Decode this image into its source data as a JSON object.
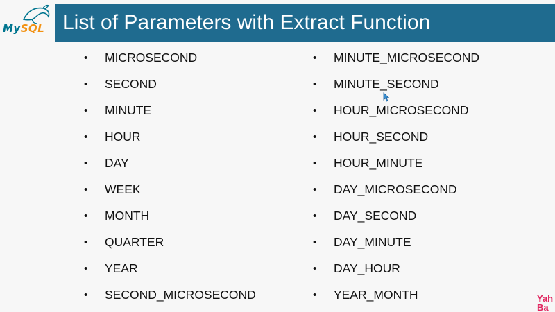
{
  "slide": {
    "title": "List of Parameters with Extract Function",
    "logo": {
      "part1": "My",
      "part2": "SQL",
      "icon": "dolphin-icon"
    },
    "left_items": [
      "MICROSECOND",
      "SECOND",
      "MINUTE",
      "HOUR",
      "DAY",
      "WEEK",
      "MONTH",
      "QUARTER",
      "YEAR",
      "SECOND_MICROSECOND"
    ],
    "right_items": [
      "MINUTE_MICROSECOND",
      "MINUTE_SECOND",
      "HOUR_MICROSECOND",
      "HOUR_SECOND",
      "HOUR_MINUTE",
      "DAY_MICROSECOND",
      "DAY_SECOND",
      "DAY_MINUTE",
      "DAY_HOUR",
      "YEAR_MONTH"
    ],
    "bullet": "•",
    "watermark": {
      "line1": "Yah",
      "line2": "Ba"
    }
  },
  "colors": {
    "title_bar": "#1f6b8f",
    "title_text": "#ffffff",
    "mysql_blue": "#00758f",
    "mysql_orange": "#f29111",
    "watermark": "#e0245e"
  }
}
